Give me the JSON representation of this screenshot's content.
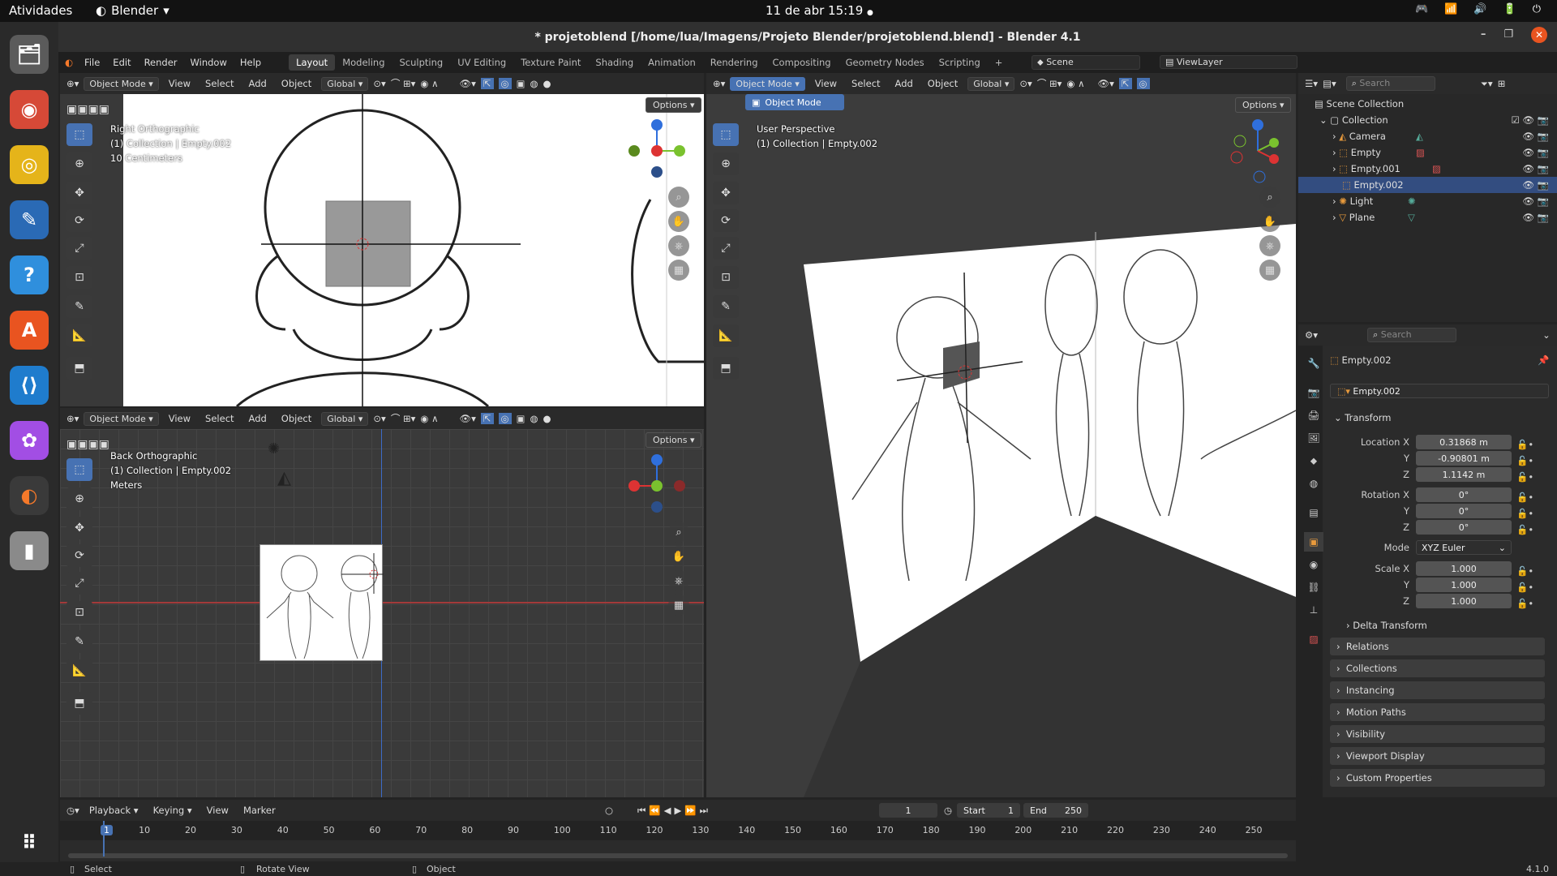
{
  "gnome": {
    "activities": "Atividades",
    "app": "Blender",
    "app_arrow": "▾",
    "clock": "11 de abr  15:19",
    "dot": "●",
    "tray": [
      "🎮",
      "📶",
      "🔊",
      "🔋",
      "⏻"
    ]
  },
  "dock": [
    {
      "name": "files-icon",
      "glyph": "🗂",
      "color": "#5b5b5b"
    },
    {
      "name": "chrome-icon",
      "glyph": "◉",
      "color": "#d64937"
    },
    {
      "name": "rhythmbox-icon",
      "glyph": "◎",
      "color": "#e5b41a"
    },
    {
      "name": "writer-icon",
      "glyph": "✎",
      "color": "#2a6ab5"
    },
    {
      "name": "help-icon",
      "glyph": "?",
      "color": "#2f8fdd"
    },
    {
      "name": "app-center-icon",
      "glyph": "A",
      "color": "#e95420"
    },
    {
      "name": "vscode-icon",
      "glyph": "⟨⟩",
      "color": "#1f7ccd"
    },
    {
      "name": "figma-icon",
      "glyph": "✿",
      "color": "#a24ee4"
    },
    {
      "name": "blender-icon",
      "glyph": "◐",
      "color": "#f5792a"
    },
    {
      "name": "disk-icon",
      "glyph": "▮",
      "color": "#8a8a8a"
    },
    {
      "name": "apps-grid-icon",
      "glyph": "⠿",
      "color": "#2a2a2a"
    }
  ],
  "window": {
    "title": "* projetoblend [/home/lua/Imagens/Projeto Blender/projetoblend.blend] - Blender 4.1",
    "min": "–",
    "max": "❐",
    "close": "✕"
  },
  "menu": [
    "File",
    "Edit",
    "Render",
    "Window",
    "Help"
  ],
  "workspaces": [
    "Layout",
    "Modeling",
    "Sculpting",
    "UV Editing",
    "Texture Paint",
    "Shading",
    "Animation",
    "Rendering",
    "Compositing",
    "Geometry Nodes",
    "Scripting",
    "+"
  ],
  "scene": "Scene",
  "viewlayer": "ViewLayer",
  "vp_header": {
    "mode": "Object Mode",
    "view": "View",
    "select": "Select",
    "add": "Add",
    "object": "Object",
    "orient": "Global",
    "options": "Options"
  },
  "vp_right_ortho": {
    "line1": "Right Orthographic",
    "line2": "(1) Collection | Empty.002",
    "line3": "10 Centimeters"
  },
  "vp_back_ortho": {
    "line1": "Back Orthographic",
    "line2": "(1) Collection | Empty.002",
    "line3": "Meters"
  },
  "vp_persp": {
    "line1": "User Perspective",
    "line2": "(1) Collection | Empty.002",
    "mode_dropdown_item": "Object Mode"
  },
  "outliner": {
    "search": "Search",
    "root": "Scene Collection",
    "collection": "Collection",
    "items": [
      "Camera",
      "Empty",
      "Empty.001",
      "Empty.002",
      "Light",
      "Plane"
    ]
  },
  "properties": {
    "search": "Search",
    "object": "Empty.002",
    "object_field": "Empty.002",
    "transform": "Transform",
    "loc_label": "Location X",
    "loc": [
      "0.31868 m",
      "-0.90801 m",
      "1.1142 m"
    ],
    "rot_label": "Rotation X",
    "rot": [
      "0°",
      "0°",
      "0°"
    ],
    "axis_y": "Y",
    "axis_z": "Z",
    "mode_label": "Mode",
    "mode": "XYZ Euler",
    "scale_label": "Scale X",
    "scale": [
      "1.000",
      "1.000",
      "1.000"
    ],
    "delta": "Delta Transform",
    "panels": [
      "Relations",
      "Collections",
      "Instancing",
      "Motion Paths",
      "Visibility",
      "Viewport Display",
      "Custom Properties"
    ]
  },
  "timeline": {
    "menus": [
      "Playback",
      "Keying",
      "View",
      "Marker"
    ],
    "current": "1",
    "start_label": "Start",
    "start": "1",
    "end_label": "End",
    "end": "250",
    "ticks": [
      "1",
      "10",
      "20",
      "30",
      "40",
      "50",
      "60",
      "70",
      "80",
      "90",
      "100",
      "110",
      "120",
      "130",
      "140",
      "150",
      "160",
      "170",
      "180",
      "190",
      "200",
      "210",
      "220",
      "230",
      "240",
      "250"
    ]
  },
  "status": {
    "select": "Select",
    "rotate": "Rotate View",
    "object": "Object",
    "version": "4.1.0"
  }
}
